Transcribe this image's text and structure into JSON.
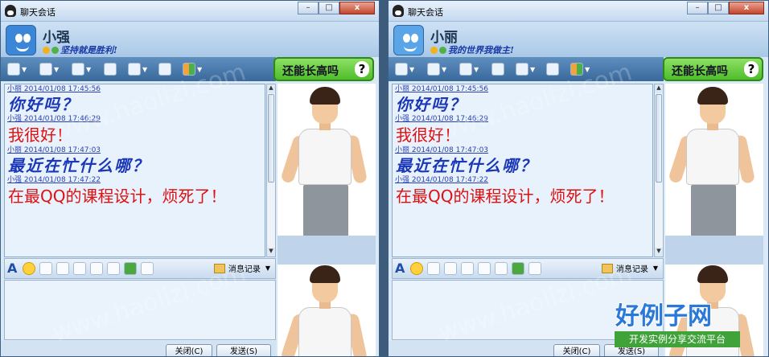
{
  "windows": [
    {
      "title": "聊天会话",
      "contact_name": "小强",
      "signature": "坚持就是胜利!",
      "ad_text": "还能长高吗",
      "ad_q": "?",
      "messages": [
        {
          "meta": "小丽  2014/01/08 17:45:56",
          "text": "你好吗？",
          "style": "italic"
        },
        {
          "meta": "小强  2014/01/08 17:46:29",
          "text": "我很好！",
          "style": "red"
        },
        {
          "meta": "小丽  2014/01/08 17:47:03",
          "text": "最近在忙什么哪？",
          "style": "italic"
        },
        {
          "meta": "小强  2014/01/08 17:47:22",
          "text": "在最QQ的课程设计，烦死了！",
          "style": "red"
        }
      ],
      "history_label": "消息记录",
      "close_label": "关闭(C)",
      "send_label": "发送(S)"
    },
    {
      "title": "聊天会话",
      "contact_name": "小丽",
      "signature": "我的世界我做主!",
      "ad_text": "还能长高吗",
      "ad_q": "?",
      "messages": [
        {
          "meta": "小丽  2014/01/08 17:45:56",
          "text": "你好吗？",
          "style": "italic"
        },
        {
          "meta": "小强  2014/01/08 17:46:29",
          "text": "我很好！",
          "style": "red"
        },
        {
          "meta": "小丽  2014/01/08 17:47:03",
          "text": "最近在忙什么哪？",
          "style": "italic"
        },
        {
          "meta": "小强  2014/01/08 17:47:22",
          "text": "在最QQ的课程设计，烦死了！",
          "style": "red"
        }
      ],
      "history_label": "消息记录",
      "close_label": "关闭(C)",
      "send_label": "发送(S)"
    }
  ],
  "window_buttons": {
    "min": "–",
    "max": "□",
    "close": "x"
  },
  "watermark": {
    "text": "www.haolizi.com",
    "brand_big": "好例子网",
    "brand_small": "开发实例分享交流平台"
  },
  "colors": {
    "italic_msg": "#1a37b8",
    "red_msg": "#e01010",
    "ad_bg": "#4ebd2b"
  }
}
